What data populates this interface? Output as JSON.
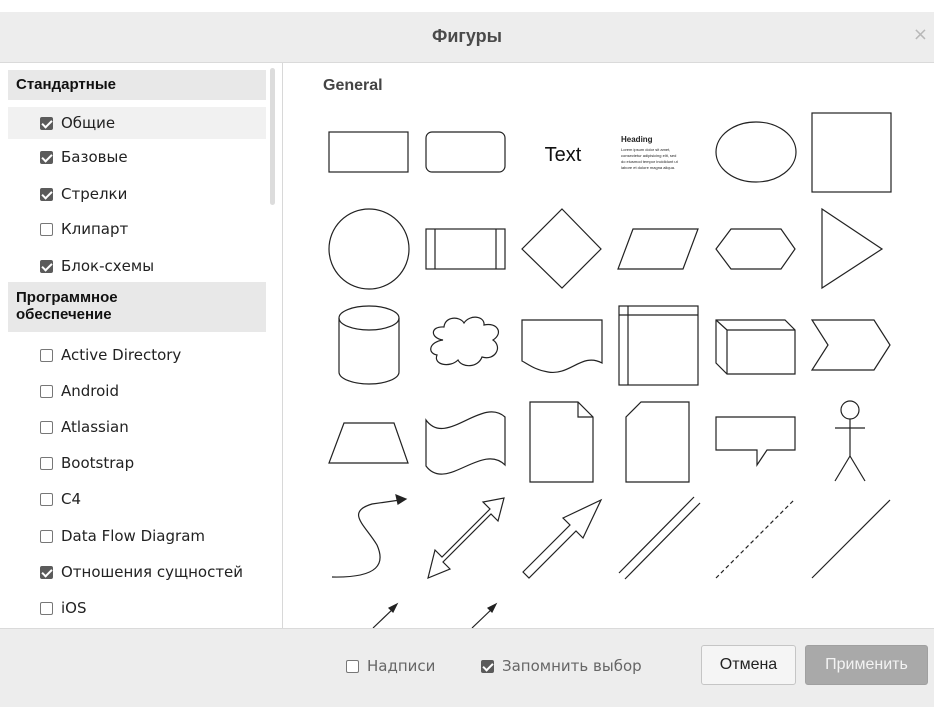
{
  "dialog": {
    "title": "Фигуры",
    "close_glyph": "×"
  },
  "sidebar": {
    "groups": [
      {
        "label": "Стандартные",
        "items": [
          {
            "label": "Общие",
            "checked": true
          },
          {
            "label": "Базовые",
            "checked": true
          },
          {
            "label": "Стрелки",
            "checked": true
          },
          {
            "label": "Клипарт",
            "checked": false
          },
          {
            "label": "Блок-схемы",
            "checked": true
          }
        ]
      },
      {
        "label_line1": "Программное",
        "label_line2": "обеспечение",
        "items": [
          {
            "label": "Active Directory",
            "checked": false
          },
          {
            "label": "Android",
            "checked": false
          },
          {
            "label": "Atlassian",
            "checked": false
          },
          {
            "label": "Bootstrap",
            "checked": false
          },
          {
            "label": "C4",
            "checked": false
          },
          {
            "label": "Data Flow Diagram",
            "checked": false
          },
          {
            "label": "Отношения сущностей",
            "checked": true
          },
          {
            "label": "iOS",
            "checked": false
          }
        ]
      }
    ]
  },
  "gallery": {
    "heading": "General",
    "shapes": {
      "text_label": "Text",
      "heading_label": "Heading",
      "lorem": [
        "Lorem ipsum dolor sit amet,",
        "consectetur adipisicing elit, sed",
        "do eiusmod tempor incididunt ut",
        "labore et dolore magna aliqua."
      ]
    }
  },
  "footer": {
    "labels_option": {
      "label": "Надписи",
      "checked": false
    },
    "remember_option": {
      "label": "Запомнить выбор",
      "checked": true
    },
    "cancel_label": "Отмена",
    "apply_label": "Применить"
  },
  "colors": {
    "apply_button": "#a9a9a9",
    "header_bg": "#ededed",
    "checkbox_checked": "#5b5b5b"
  }
}
